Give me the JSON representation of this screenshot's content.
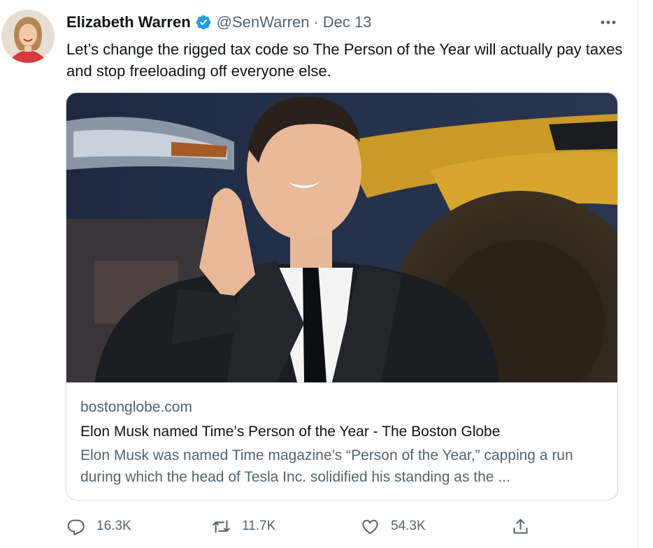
{
  "tweet": {
    "author_name": "Elizabeth Warren",
    "handle": "@SenWarren",
    "separator": "·",
    "date": "Dec 13",
    "more_label": "•••",
    "text": "Let’s change the rigged tax code so The Person of the Year will actually pay taxes and stop freeloading off everyone else."
  },
  "card": {
    "domain": "bostonglobe.com",
    "title": "Elon Musk named Time’s Person of the Year - The Boston Globe",
    "description": "Elon Musk was named Time magazine’s “Person of the Year,” capping a run during which the head of Tesla Inc. solidified his standing as the ..."
  },
  "actions": {
    "replies": "16.3K",
    "retweets": "11.7K",
    "likes": "54.3K"
  },
  "icons": {
    "verified": "verified-badge-icon",
    "more": "more-horizontal-icon",
    "reply": "reply-icon",
    "retweet": "retweet-icon",
    "like": "heart-icon",
    "share": "share-icon"
  },
  "colors": {
    "verified_blue": "#1d9bf0",
    "secondary_text": "#536471",
    "border": "#cfd9de"
  }
}
